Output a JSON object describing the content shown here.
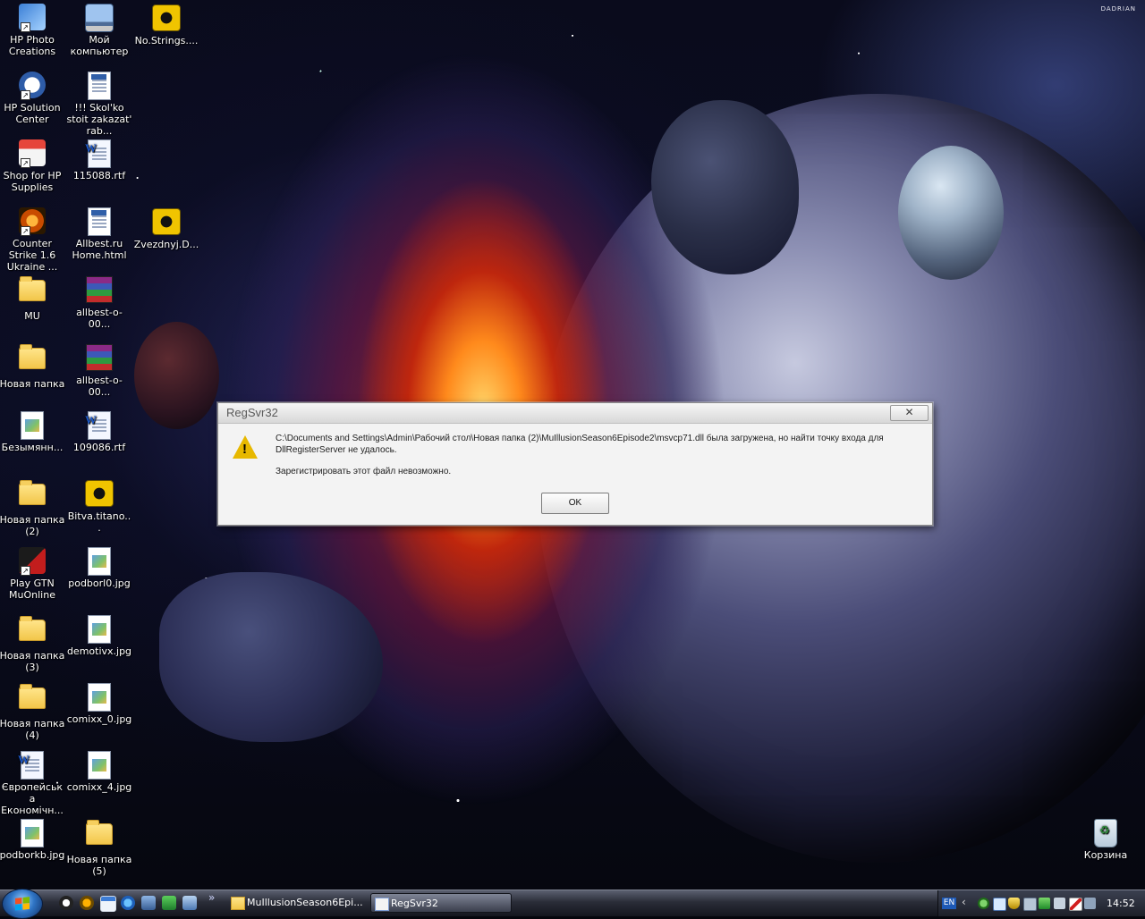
{
  "wallpaper": {
    "brand": "DADRIAN"
  },
  "desktop_icons": [
    {
      "label": "HP Photo Creations"
    },
    {
      "label": "Мой компьютер"
    },
    {
      "label": "No.Strings...."
    },
    {
      "label": "HP Solution Center"
    },
    {
      "label": "!!! Skol'ko stoit zakazat' rab..."
    },
    {
      "label": "Shop for HP Supplies"
    },
    {
      "label": "115088.rtf"
    },
    {
      "label": "Counter Strike 1.6 Ukraine ..."
    },
    {
      "label": "Allbest.ru Home.html"
    },
    {
      "label": "Zvezdnyj.D..."
    },
    {
      "label": "MU"
    },
    {
      "label": "allbest-o-00..."
    },
    {
      "label": "Новая папка"
    },
    {
      "label": "allbest-o-00..."
    },
    {
      "label": "Безымянн..."
    },
    {
      "label": "109086.rtf"
    },
    {
      "label": "Новая папка (2)"
    },
    {
      "label": "Bitva.titano..."
    },
    {
      "label": "Play GTN MuOnline"
    },
    {
      "label": "podborl0.jpg"
    },
    {
      "label": "Новая папка (3)"
    },
    {
      "label": "demotivx.jpg"
    },
    {
      "label": "Новая папка (4)"
    },
    {
      "label": "comixx_0.jpg"
    },
    {
      "label": "Європейська Економічн..."
    },
    {
      "label": "comixx_4.jpg"
    },
    {
      "label": "podborkb.jpg"
    },
    {
      "label": "Новая папка (5)"
    },
    {
      "label": "Корзина"
    }
  ],
  "dialog": {
    "title": "RegSvr32",
    "close_symbol": "✕",
    "warning_mark": "!",
    "message": "C:\\Documents and Settings\\Admin\\Рабочий стол\\Новая папка (2)\\MuIllusionSeason6Episode2\\msvcp71.dll была загружена, но найти точку входа для DllRegisterServer не удалось.",
    "message2": "Зарегистрировать этот файл невозможно.",
    "ok_label": "OK"
  },
  "taskbar": {
    "quicklaunch_more": "»",
    "tasks": [
      {
        "label": "MuIllusionSeason6Epi..."
      },
      {
        "label": "RegSvr32"
      }
    ],
    "tray": {
      "language": "EN",
      "expand": "‹",
      "clock": "14:52"
    }
  }
}
